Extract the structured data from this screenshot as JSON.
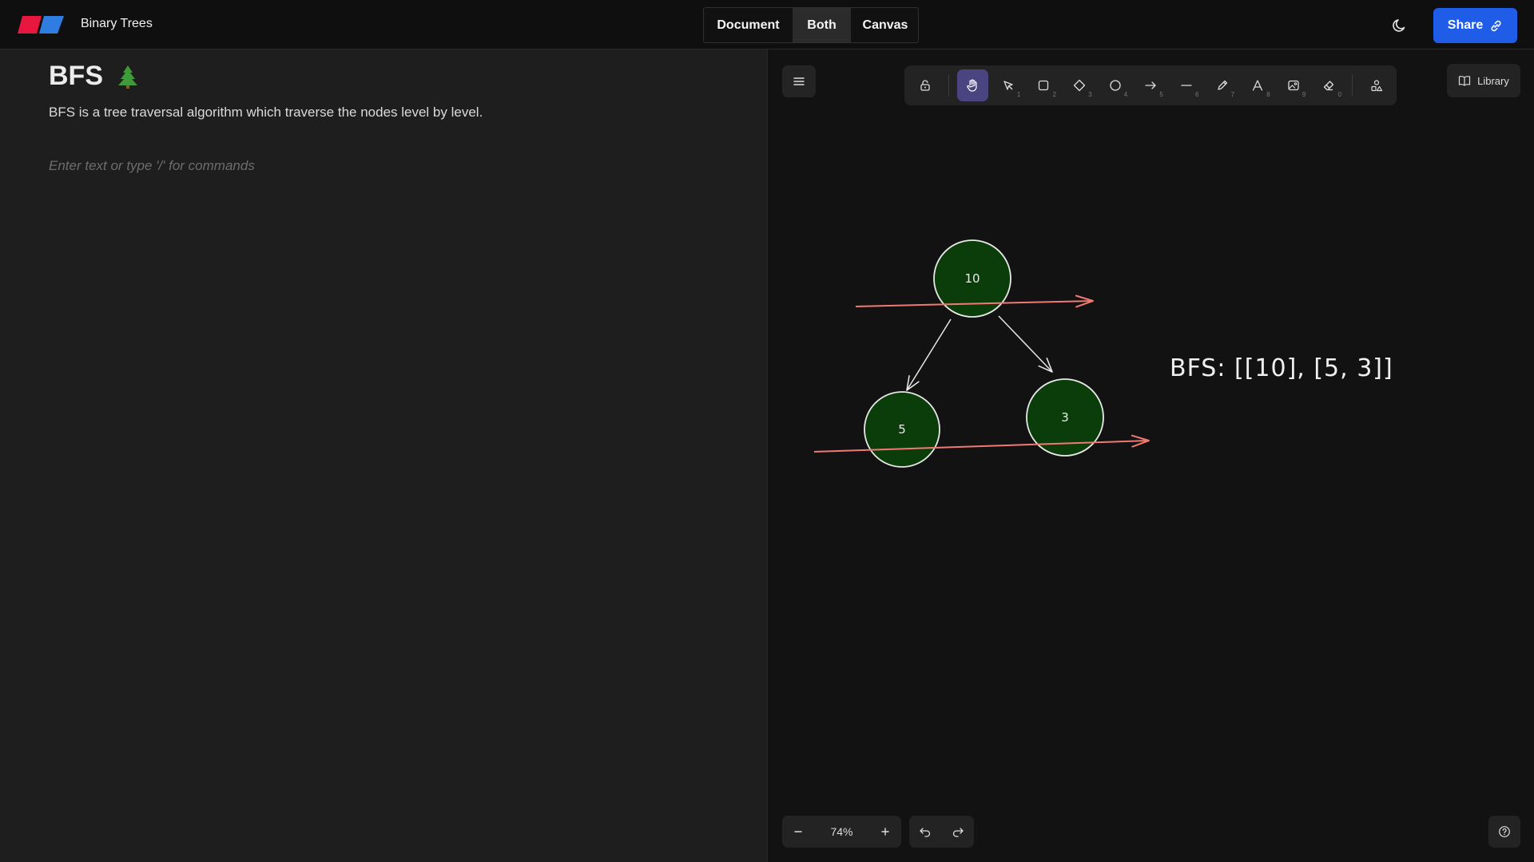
{
  "header": {
    "app_title": "Binary Trees",
    "view_modes": [
      "Document",
      "Both",
      "Canvas"
    ],
    "active_view": "Both",
    "share_label": "Share",
    "accent_color": "#1f5ce8"
  },
  "document": {
    "title": "BFS",
    "title_emoji": "🌲",
    "body": "BFS is a tree traversal algorithm which traverse the nodes level by level.",
    "placeholder": "Enter text or type '/' for commands"
  },
  "canvas": {
    "tools": [
      {
        "name": "lock-icon",
        "key": ""
      },
      {
        "name": "hand-icon",
        "key": "",
        "active": true
      },
      {
        "name": "selection-icon",
        "key": "1"
      },
      {
        "name": "rectangle-icon",
        "key": "2"
      },
      {
        "name": "diamond-icon",
        "key": "3"
      },
      {
        "name": "ellipse-icon",
        "key": "4"
      },
      {
        "name": "arrow-icon",
        "key": "5"
      },
      {
        "name": "line-icon",
        "key": "6"
      },
      {
        "name": "pencil-icon",
        "key": "7"
      },
      {
        "name": "text-icon",
        "key": "8"
      },
      {
        "name": "image-icon",
        "key": "9"
      },
      {
        "name": "eraser-icon",
        "key": "0"
      },
      {
        "name": "shapes-library-icon",
        "key": ""
      }
    ],
    "library_label": "Library",
    "nodes": [
      "10",
      "5",
      "3"
    ],
    "annotation": "BFS: [[10], [5, 3]]",
    "node_fill": "#0b3d0b",
    "level_arrow_color": "#f07a72",
    "zoom": "74%"
  }
}
